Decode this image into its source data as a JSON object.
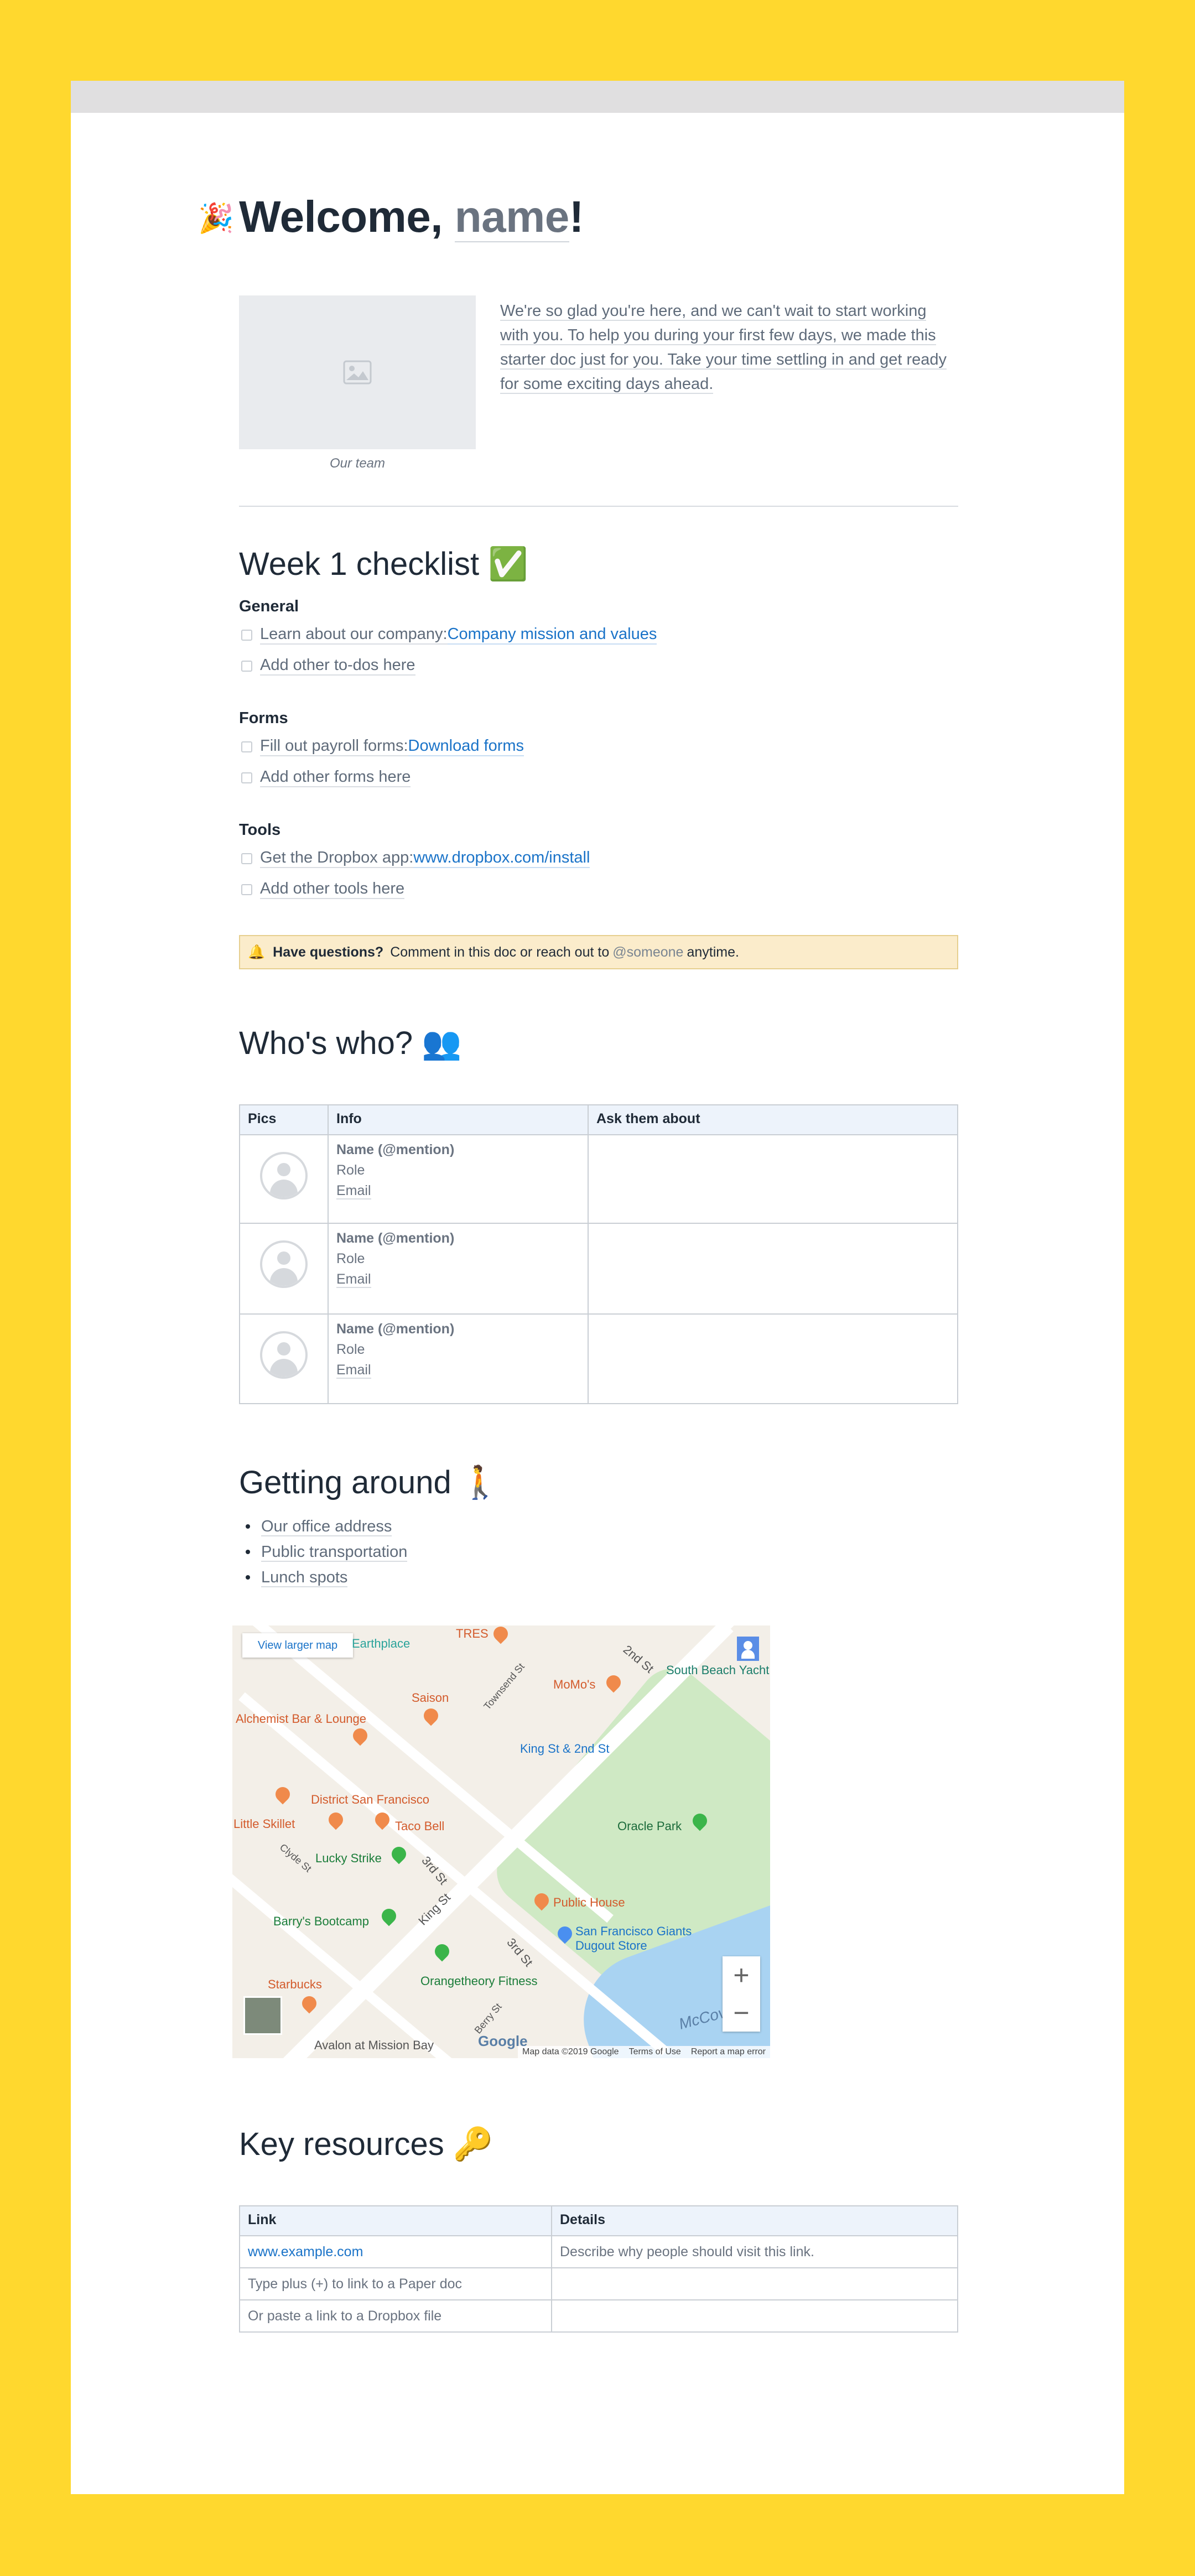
{
  "welcome": {
    "emoji": "🎉",
    "prefix": "Welcome, ",
    "name": "name",
    "suffix": "!",
    "image_caption": "Our team",
    "intro": "We're so glad you're here, and we can't wait to start working with you. To help you during your first few days, we made this starter doc just for you. Take your time settling in and get ready for some exciting days ahead."
  },
  "checklist": {
    "title": "Week 1 checklist",
    "emoji": "✅",
    "sections": [
      {
        "heading": "General",
        "items": [
          {
            "text": "Learn about our company: ",
            "link": "Company mission and values"
          },
          {
            "text": "Add other to-dos here",
            "link": ""
          }
        ]
      },
      {
        "heading": "Forms",
        "items": [
          {
            "text": "Fill out payroll forms: ",
            "link": "Download forms"
          },
          {
            "text": "Add other forms here",
            "link": ""
          }
        ]
      },
      {
        "heading": "Tools",
        "items": [
          {
            "text": "Get the Dropbox app: ",
            "link": "www.dropbox.com/install"
          },
          {
            "text": "Add other tools here",
            "link": ""
          }
        ]
      }
    ]
  },
  "callout": {
    "emoji": "🔔",
    "bold": "Have questions?",
    "text": "Comment in this doc or reach out to",
    "mention": "@someone",
    "tail": "anytime."
  },
  "whos_who": {
    "title": "Who's who?",
    "emoji": "👥",
    "columns": [
      "Pics",
      "Info",
      "Ask them about"
    ],
    "rows": [
      {
        "name": "Name (@mention)",
        "role": "Role",
        "email": "Email",
        "ask": ""
      },
      {
        "name": "Name (@mention)",
        "role": "Role",
        "email": "Email",
        "ask": ""
      },
      {
        "name": "Name (@mention)",
        "role": "Role",
        "email": "Email",
        "ask": ""
      }
    ]
  },
  "getting_around": {
    "title": "Getting around",
    "emoji": "🚶",
    "items": [
      "Our office address",
      "Public transportation",
      "Lunch spots"
    ]
  },
  "map": {
    "view_larger": "View larger map",
    "labels": {
      "earthplace": "Earthplace",
      "tres": "TRES",
      "second_st": "2nd St",
      "south_beach": "South Beach Yacht",
      "townsend": "Townsend St",
      "momos": "MoMo's",
      "saison": "Saison",
      "alchemist": "Alchemist Bar & Lounge",
      "king_2nd": "King St & 2nd St",
      "district": "District San Francisco",
      "little_skillet": "Little Skillet",
      "taco_bell": "Taco Bell",
      "oracle_park": "Oracle Park",
      "clyde": "Clyde St",
      "lucky_strike": "Lucky Strike",
      "third_st": "3rd St",
      "public_house": "Public House",
      "barrys": "Barry's Bootcamp",
      "king_st": "King St",
      "sf_giants": "San Francisco Giants Dugout Store",
      "third_st_2": "3rd St",
      "orangetheory": "Orangetheory Fitness",
      "starbucks": "Starbucks",
      "berry": "Berry St",
      "mccovey": "McCove",
      "avalon": "Avalon at Mission Bay",
      "google": "Google",
      "map_data": "Map data ©2019 Google",
      "terms": "Terms of Use",
      "report": "Report a map error"
    },
    "zoom_in": "+",
    "zoom_out": "−"
  },
  "resources": {
    "title": "Key resources",
    "emoji": "🔑",
    "columns": [
      "Link",
      "Details"
    ],
    "rows": [
      {
        "link": "www.example.com",
        "details": "Describe why people should visit this link."
      },
      {
        "link": "Type plus (+) to link to a Paper doc",
        "details": ""
      },
      {
        "link": "Or paste a link to a Dropbox file",
        "details": ""
      }
    ]
  }
}
